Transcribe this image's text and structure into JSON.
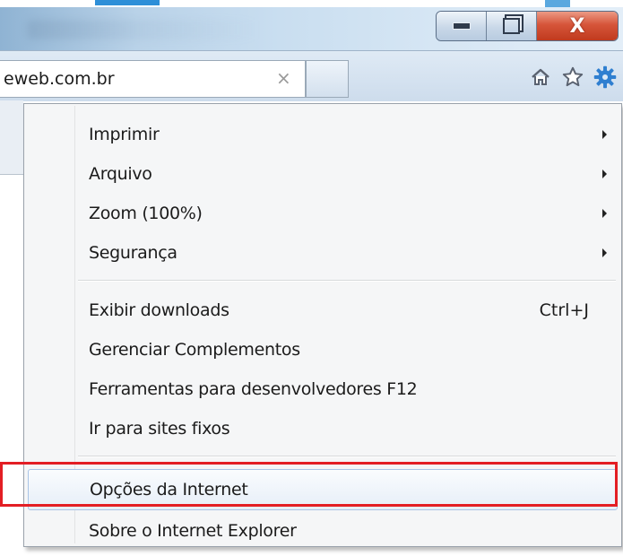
{
  "browser": {
    "url_fragment": "eweb.com.br",
    "tab_close_glyph": "×",
    "window_controls": {
      "minimize_glyph": "",
      "close_glyph": "X"
    },
    "toolbar_icons": [
      "home-icon",
      "favorites-star-icon",
      "tools-gear-icon"
    ]
  },
  "menu": {
    "items": [
      {
        "label": "Imprimir",
        "submenu": true
      },
      {
        "label": "Arquivo",
        "submenu": true
      },
      {
        "label": "Zoom (100%)",
        "submenu": true
      },
      {
        "label": "Segurança",
        "submenu": true
      },
      {
        "label": "Exibir downloads",
        "shortcut": "Ctrl+J"
      },
      {
        "label": "Gerenciar Complementos"
      },
      {
        "label": "Ferramentas para desenvolvedores F12"
      },
      {
        "label": "Ir para sites fixos"
      },
      {
        "label": "Opções da Internet",
        "highlighted": true
      },
      {
        "label": "Sobre o Internet Explorer"
      }
    ]
  },
  "colors": {
    "highlight_outline": "#e31e24",
    "menu_background": "#f5f6f7",
    "gear_icon": "#2f7fd0",
    "close_button": "#c03a1e"
  }
}
